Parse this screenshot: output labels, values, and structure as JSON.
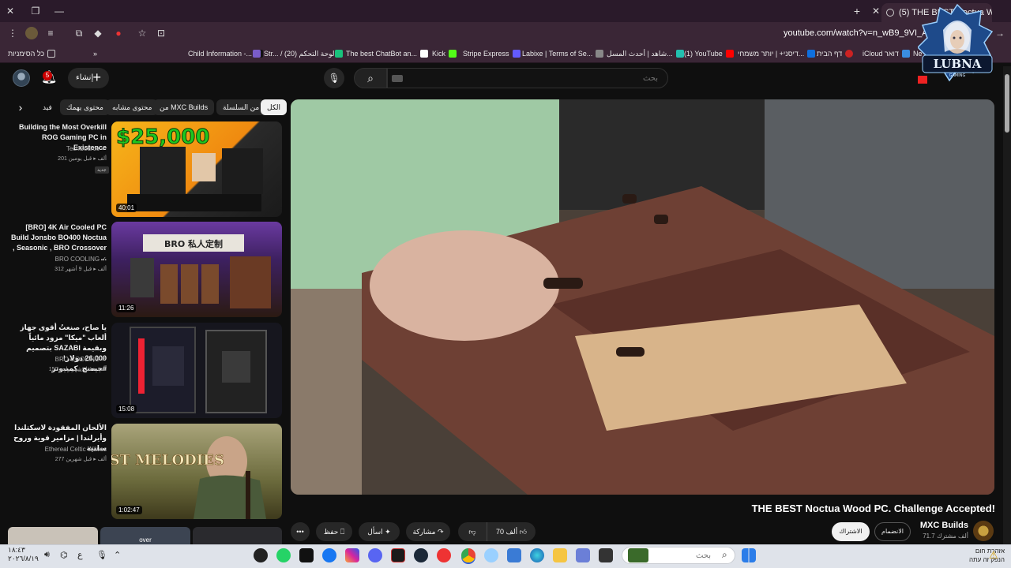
{
  "browser": {
    "active_tab_title": "(5) THE BEST Noctua Wood PC",
    "url": "youtube.com/watch?v=n_wB9_9VI_A&t=25",
    "bookmarks": [
      {
        "label": "כל הסימניות",
        "color": "#888"
      },
      {
        "label": "Child Information -...",
        "color": "#000000"
      },
      {
        "label": "Str... / لوحة التحكم (20)",
        "color": "#7a5cc8"
      },
      {
        "label": "The best ChatBot an...",
        "color": "#ffffff"
      },
      {
        "label": "Kick",
        "color": "#53fc18"
      },
      {
        "label": "Stripe Express",
        "color": "#635bff"
      },
      {
        "label": "Labixe | Terms of Se...",
        "color": "#888888"
      },
      {
        "label": "شاهد | أحدث المسل...",
        "color": "#22c0b0"
      },
      {
        "label": "(1) YouTube",
        "color": "#ff0000"
      },
      {
        "label": "דיסני+ | יותר משמחי...",
        "color": "#0f6fde"
      },
      {
        "label": "דף הבית",
        "color": "#cc2222"
      },
      {
        "label": "iCloud דואר",
        "color": "#3a8de0"
      },
      {
        "label": "Ne",
        "color": "#ffffff"
      }
    ],
    "logo_text": "LUBNA",
    "logo_subtext": "GAMING"
  },
  "youtube": {
    "notifications_count": "5",
    "create_label": "إنشاء",
    "search_placeholder": "بحث",
    "chips": [
      "الكل",
      "من السلسلة",
      "من MXC Builds",
      "محتوى مشابه",
      "محتوى يهمك",
      "فيد"
    ],
    "video": {
      "title": "THE BEST Noctua Wood PC. Challenge Accepted!",
      "channel": "MXC Builds",
      "subscribers": "71.7 ألف مشترك",
      "subscribe_label": "الاشتراك",
      "join_label": "الانضمام",
      "likes": "70 ألف",
      "share_label": "مشاركة",
      "ask_label": "اسأل",
      "save_label": "حفظ"
    },
    "related": [
      {
        "title": "Building the Most Overkill ROG Gaming PC in Existence",
        "channel": "TechSource",
        "views": "201 ألف",
        "age": "قبل يومين",
        "duration": "40:01",
        "badge": "جديد",
        "thumb_text": "$25,000"
      },
      {
        "title": "[BRO] 4K Air Cooled PC Build  Jonsbo BO400 Noctua , Seasonic , BRO Crossover ...",
        "channel": "BRO COOLING",
        "views": "312 ألف",
        "age": "قبل 9 أشهر",
        "duration": "11:26",
        "thumb_text": "BRO 私人定制"
      },
      {
        "title": "يا صاح، صنعتُ أقوى جهاز ألعاب \"ميكا\" مزود مائياً بتصميم SAZABI وبقيمة 26,000 دولار! #جيمنج_كمبيوتر",
        "channel": "BRO COOLING",
        "views": "150 ألف",
        "age": "قبل شهر واحد",
        "duration": "15:08"
      },
      {
        "title": "الألحان المفقودة لاسكتلندا وأيرلندا | مزامير قوية وروح سلتية",
        "channel": "Ethereal Celtic Waves",
        "views": "277 ألف",
        "age": "قبل شهرين",
        "duration": "1:02:47",
        "thumb_text": "LOST MELODIES"
      }
    ],
    "next_row_label": "over"
  },
  "taskbar": {
    "search_placeholder": "بحث",
    "time": "١٨:٤٣",
    "date": "٢٠٢٦/٨/١٩",
    "weather_title": "אזהרת חום",
    "weather_sub": "הנפק זה עתה",
    "lang": "ع"
  }
}
